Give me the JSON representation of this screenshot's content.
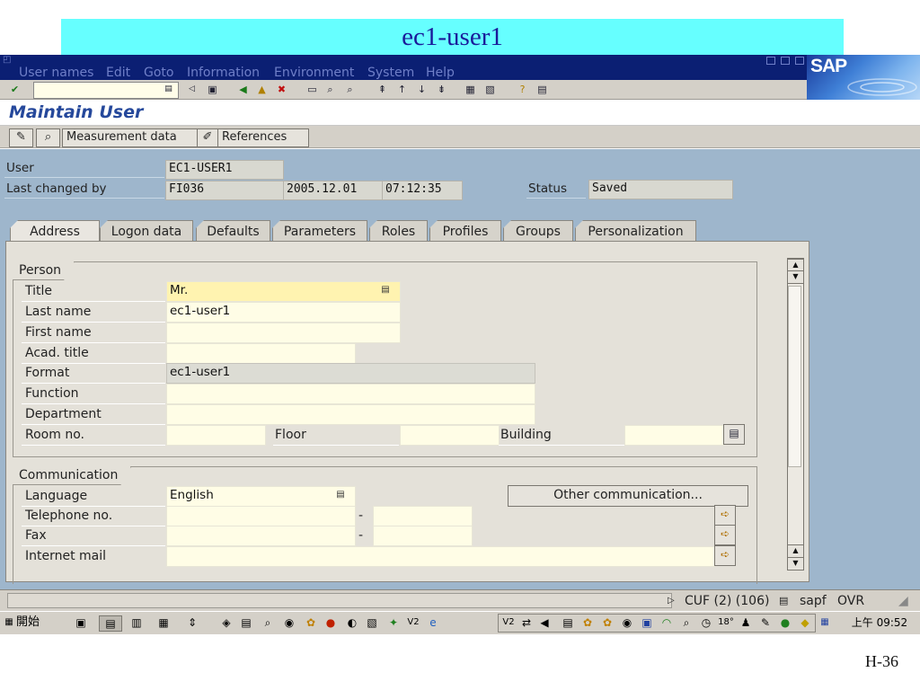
{
  "slide_title": "ec1-user1",
  "menu": [
    "User names",
    "Edit",
    "Goto",
    "Information",
    "Environment",
    "System",
    "Help"
  ],
  "brand": "SAP",
  "screen_title": "Maintain User",
  "app_toolbar": {
    "measurement_label": "Measurement data",
    "references_label": "References"
  },
  "header": {
    "user_label": "User",
    "user_value": "EC1-USER1",
    "last_changed_label": "Last changed by",
    "last_changed_value": "FI036",
    "date_value": "2005.12.01",
    "time_value": "07:12:35",
    "status_label": "Status",
    "status_value": "Saved"
  },
  "tabs": [
    "Address",
    "Logon data",
    "Defaults",
    "Parameters",
    "Roles",
    "Profiles",
    "Groups",
    "Personalization"
  ],
  "active_tab": "Address",
  "person": {
    "group_title": "Person",
    "title_label": "Title",
    "title_value": "Mr.",
    "last_name_label": "Last name",
    "last_name_value": "ec1-user1",
    "first_name_label": "First name",
    "first_name_value": "",
    "acad_title_label": "Acad. title",
    "acad_title_value": "",
    "format_label": "Format",
    "format_value": "ec1-user1",
    "function_label": "Function",
    "function_value": "",
    "department_label": "Department",
    "department_value": "",
    "room_label": "Room no.",
    "floor_label": "Floor",
    "building_label": "Building"
  },
  "communication": {
    "group_title": "Communication",
    "language_label": "Language",
    "language_value": "English",
    "other_comm_label": "Other communication...",
    "telephone_label": "Telephone no.",
    "fax_label": "Fax",
    "email_label": "Internet mail",
    "dash": "-"
  },
  "status_bar": {
    "system": "CUF (2) (106)",
    "server": "sapf",
    "mode": "OVR"
  },
  "taskbar": {
    "start_label": "開始",
    "clock": "上午 09:52",
    "temperature": "18°"
  },
  "page_number": "H-36",
  "colors": {
    "slide_title_bg": "#66ffff",
    "menubar_bg": "#0b1f73",
    "content_bg": "#9eb6cc",
    "panel_bg": "#e4e1d9",
    "highlight_input": "#fff3b0"
  }
}
